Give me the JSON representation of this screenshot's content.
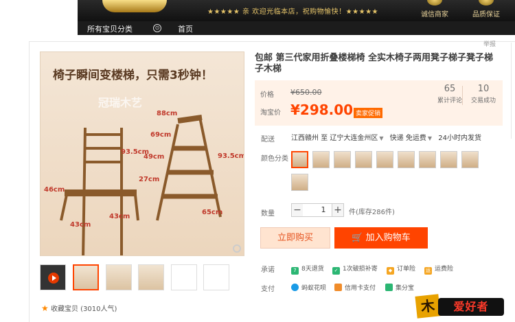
{
  "shop_banner": {
    "welcome": "★★★★★ 亲 欢迎光临本店，祝购物愉快！★★★★★",
    "badges": [
      "诚信商家",
      "品质保证"
    ]
  },
  "nav": {
    "all_categories": "所有宝贝分类",
    "circle": "⊙",
    "home": "首页"
  },
  "report_link": "举报",
  "gallery": {
    "headline": "椅子瞬间变楼梯，只需3秒钟！",
    "watermark": "冠瑞木艺",
    "dimensions": [
      "88cm",
      "69cm",
      "49cm",
      "93.5cm",
      "93.5cm",
      "27cm",
      "46cm",
      "43cm",
      "43cm",
      "65cm"
    ],
    "thumbnail_count": 6
  },
  "favorite": {
    "icon": "star-icon",
    "text": "收藏宝贝 (3010人气)"
  },
  "product": {
    "title": "包邮 第三代家用折叠楼梯椅 全实木椅子两用凳子梯子凳子梯子木梯",
    "price_label": "价格",
    "original_price": "¥650.00",
    "taobao_price_label": "淘宝价",
    "price": "¥298.00",
    "price_tag": "卖家促销",
    "reviews_count": "65",
    "reviews_label": "累计评论",
    "sales_count": "10",
    "sales_label": "交易成功"
  },
  "delivery": {
    "label": "配送",
    "from": "江西赣州",
    "to_word": "至",
    "to": "辽宁大连金州区",
    "fee": "快递 免运费",
    "ship_time": "24小时内发货"
  },
  "color_label": "颜色分类",
  "color_option_count": 10,
  "quantity": {
    "label": "数量",
    "value": "1",
    "minus": "−",
    "plus": "+",
    "stock": "件(库存286件)"
  },
  "buttons": {
    "buy_now": "立即购买",
    "add_cart": "加入购物车",
    "cart_icon": "cart-icon"
  },
  "promise": {
    "label": "承诺",
    "items": [
      {
        "icon": "return-7day-icon",
        "text": "8天退货",
        "color": "#2bb673"
      },
      {
        "icon": "damage-compensation-icon",
        "text": "1次破损补寄",
        "color": "#2bb673"
      },
      {
        "icon": "order-insurance-icon",
        "text": "订单险",
        "color": "#f5a623"
      },
      {
        "icon": "shipping-insurance-icon",
        "text": "运费险",
        "color": "#f5a623"
      }
    ]
  },
  "payment": {
    "label": "支付",
    "items": [
      {
        "icon": "huabei-icon",
        "text": "蚂蚁花呗",
        "color": "#1a9be6"
      },
      {
        "icon": "credit-card-icon",
        "text": "信用卡支付",
        "color": "#f08c2a"
      },
      {
        "icon": "jifenbao-icon",
        "text": "集分宝",
        "color": "#2bb673"
      }
    ]
  },
  "brand_logo": {
    "char": "木",
    "text": "爱好者"
  }
}
